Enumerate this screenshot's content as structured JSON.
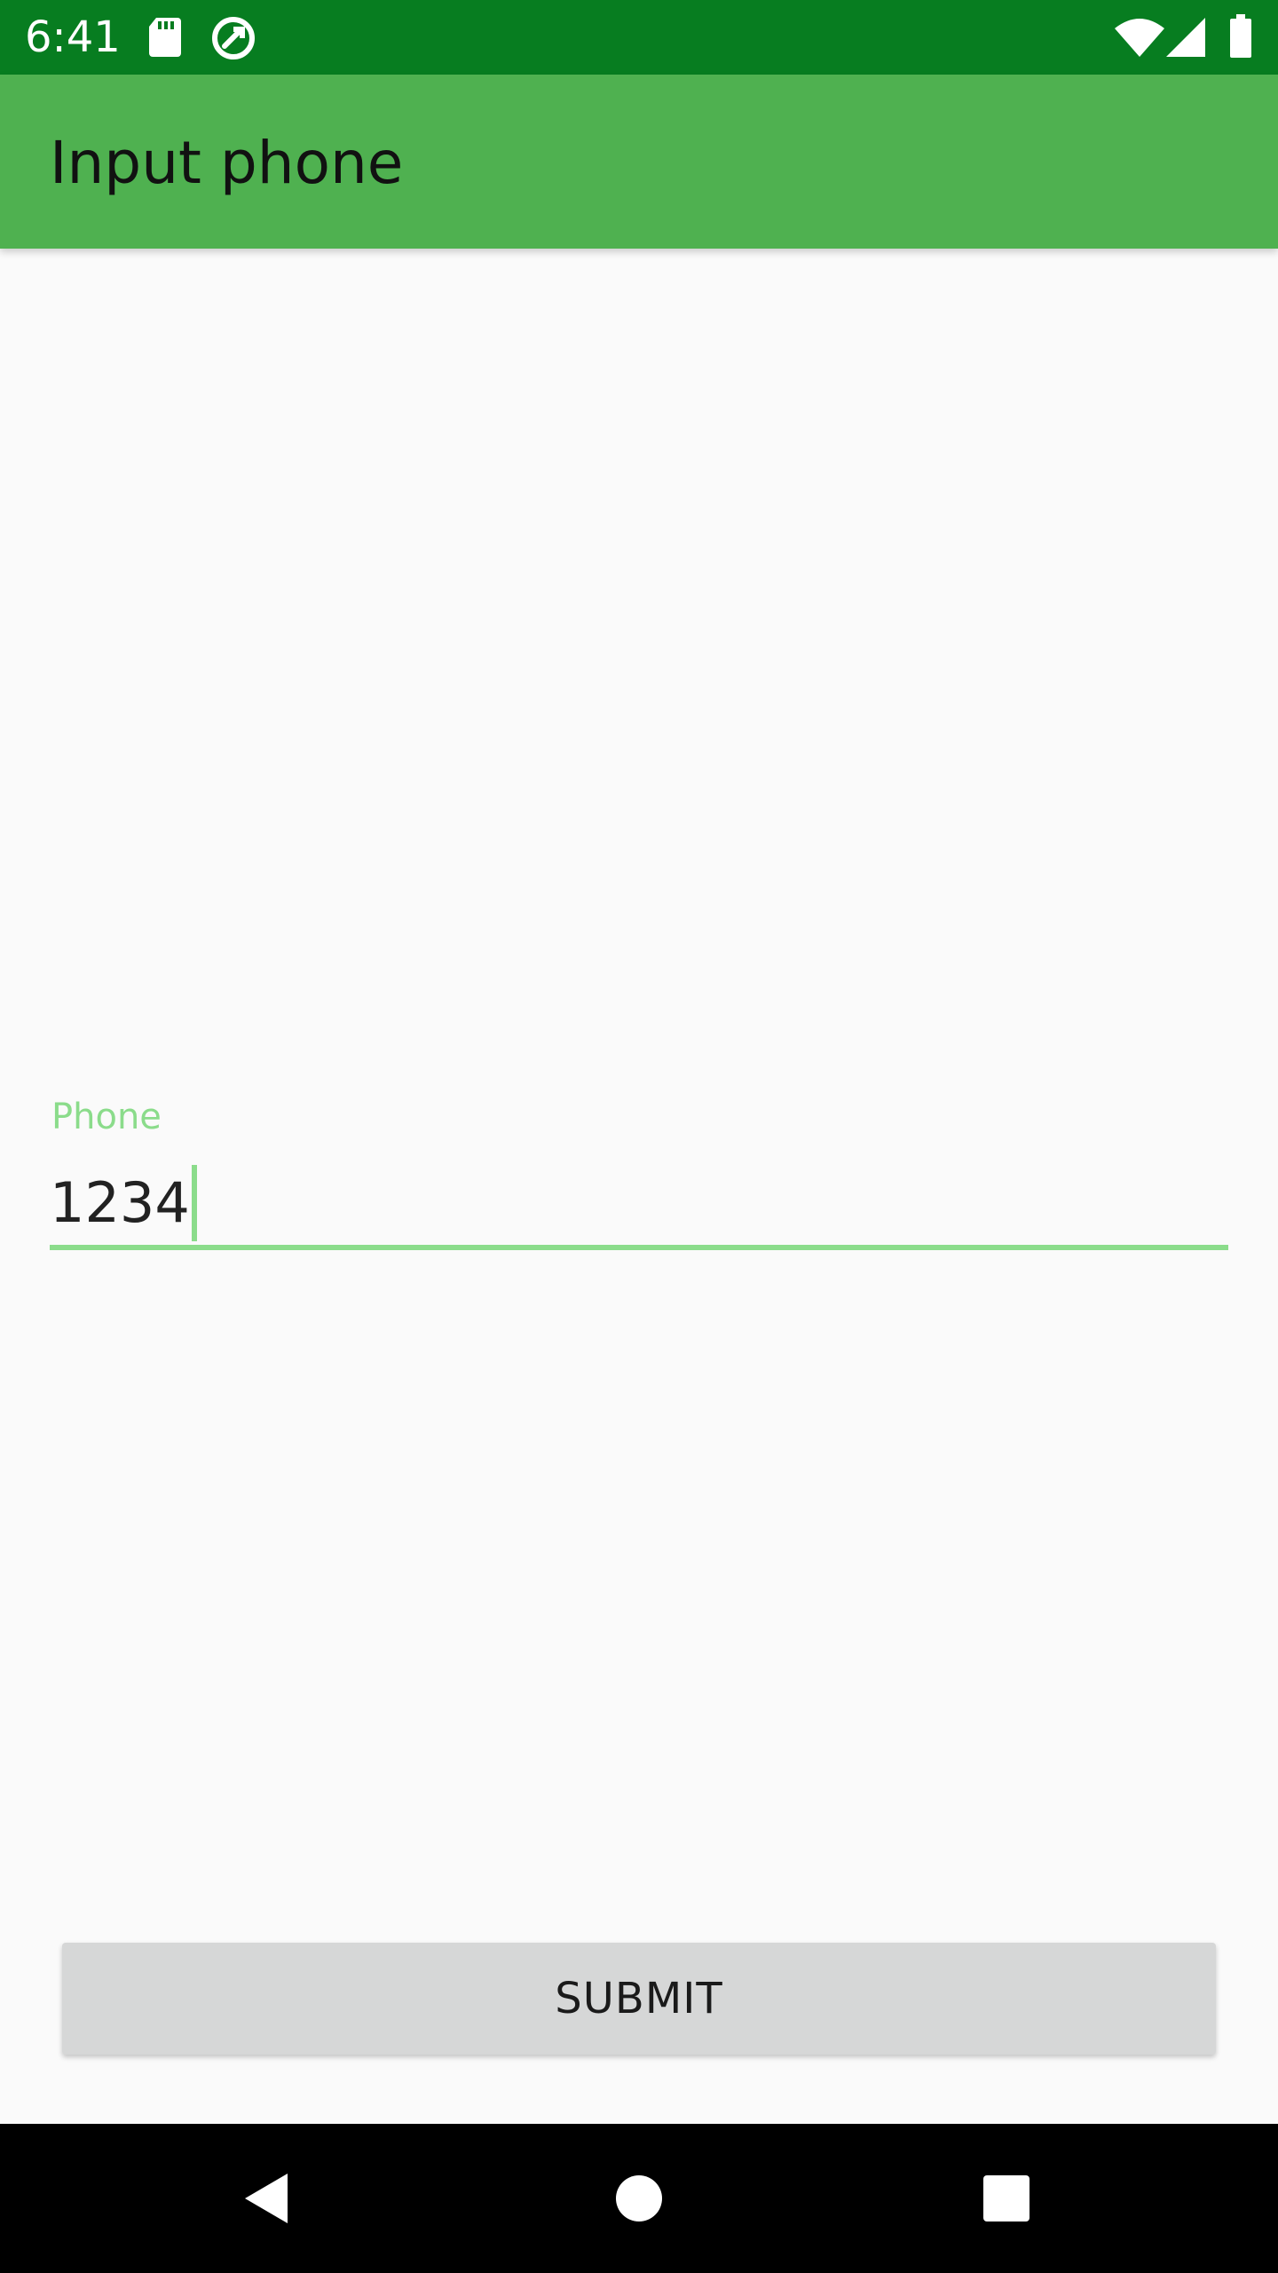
{
  "status_bar": {
    "time": "6:41",
    "icons": [
      "sd-card-icon",
      "data-saver-icon",
      "wifi-icon",
      "cellular-signal-icon",
      "battery-icon"
    ]
  },
  "app_bar": {
    "title": "Input phone"
  },
  "phone_field": {
    "label": "Phone",
    "value": "1234"
  },
  "submit_button": {
    "label": "SUBMIT"
  },
  "nav_bar": {
    "icons": [
      "back-icon",
      "home-icon",
      "recents-icon"
    ]
  },
  "colors": {
    "status_bar": "#077D20",
    "app_bar": "#4FB150",
    "accent": "#8BDC8B",
    "background": "#FAFAFA",
    "button": "#D6D7D7",
    "nav_bar": "#000000"
  }
}
